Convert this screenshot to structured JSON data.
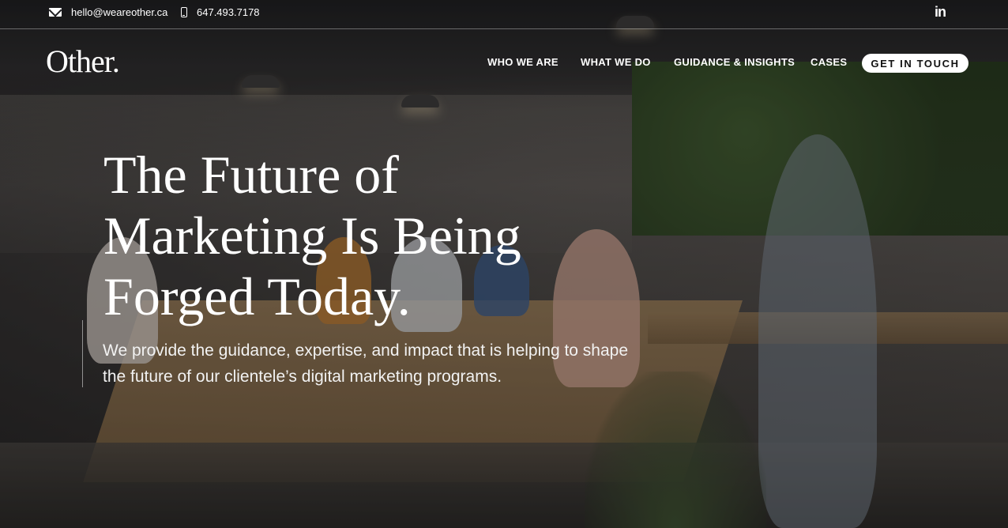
{
  "topbar": {
    "email": "hello@weareother.ca",
    "phone": "647.493.7178",
    "linkedin_label": "in"
  },
  "header": {
    "logo": "Other.",
    "nav": [
      "WHO WE ARE",
      "WHAT WE DO",
      "GUIDANCE & INSIGHTS",
      "CASES"
    ],
    "cta": "GET IN TOUCH"
  },
  "hero": {
    "headline_lines": [
      "The Future of",
      "Marketing Is Being",
      "Forged Today."
    ],
    "subtext_lines": [
      "We provide the guidance, expertise, and impact that is helping to shape",
      "the future of our clientele’s digital marketing programs."
    ]
  },
  "icons": {
    "email": "envelope-icon",
    "phone": "mobile-phone-icon",
    "social": "linkedin-icon"
  },
  "colors": {
    "text": "#ffffff",
    "cta_bg": "#ffffff",
    "cta_text": "#111111"
  }
}
